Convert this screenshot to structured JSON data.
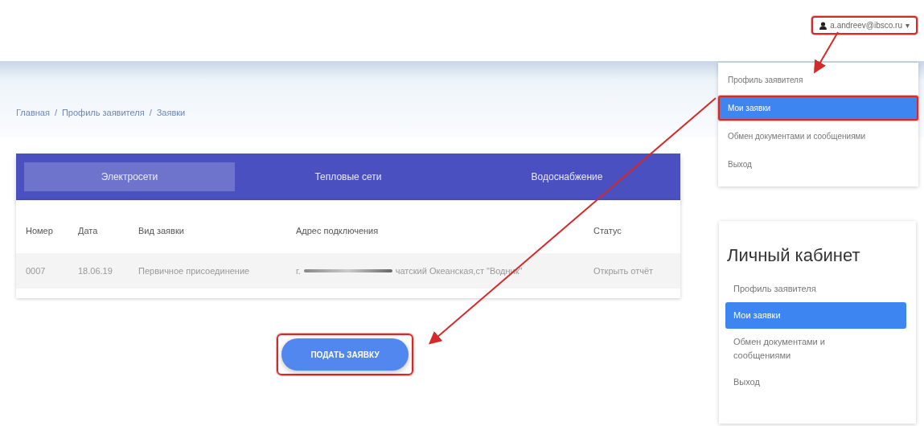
{
  "user_menu": {
    "email": "a.andreev@ibsco.ru",
    "caret": "▾",
    "highlighted": true,
    "items": [
      {
        "label": "Профиль заявителя",
        "selected": false,
        "highlighted": false
      },
      {
        "label": "Мои заявки",
        "selected": true,
        "highlighted": true
      },
      {
        "label": "Обмен документами и сообщениями",
        "selected": false,
        "highlighted": false
      },
      {
        "label": "Выход",
        "selected": false,
        "highlighted": false
      }
    ]
  },
  "breadcrumbs": [
    "Главная",
    "Профиль заявителя",
    "Заявки"
  ],
  "breadcrumb_separator": "/",
  "tabs": [
    {
      "label": "Электросети",
      "selected": true
    },
    {
      "label": "Тепловые сети",
      "selected": false
    },
    {
      "label": "Водоснабжение",
      "selected": false
    }
  ],
  "table": {
    "columns": [
      "Номер",
      "Дата",
      "Вид заявки",
      "Адрес подключения",
      "Статус"
    ],
    "rows": [
      {
        "number": "0007",
        "date": "18.06.19",
        "type": "Первичное присоединение",
        "address_start": "г.",
        "address_redacted": true,
        "address_end": "чатский Океанская,ст \"Водник\"",
        "status": "Открыть отчёт"
      }
    ]
  },
  "submit_button": {
    "label": "ПОДАТЬ ЗАЯВКУ",
    "highlighted": true
  },
  "sidebar": {
    "title": "Личный кабинет",
    "items": [
      {
        "label": "Профиль заявителя",
        "selected": false
      },
      {
        "label": "Мои заявки",
        "selected": true
      },
      {
        "label": "Обмен документами и сообщениями",
        "selected": false
      },
      {
        "label": "Выход",
        "selected": false
      }
    ]
  }
}
